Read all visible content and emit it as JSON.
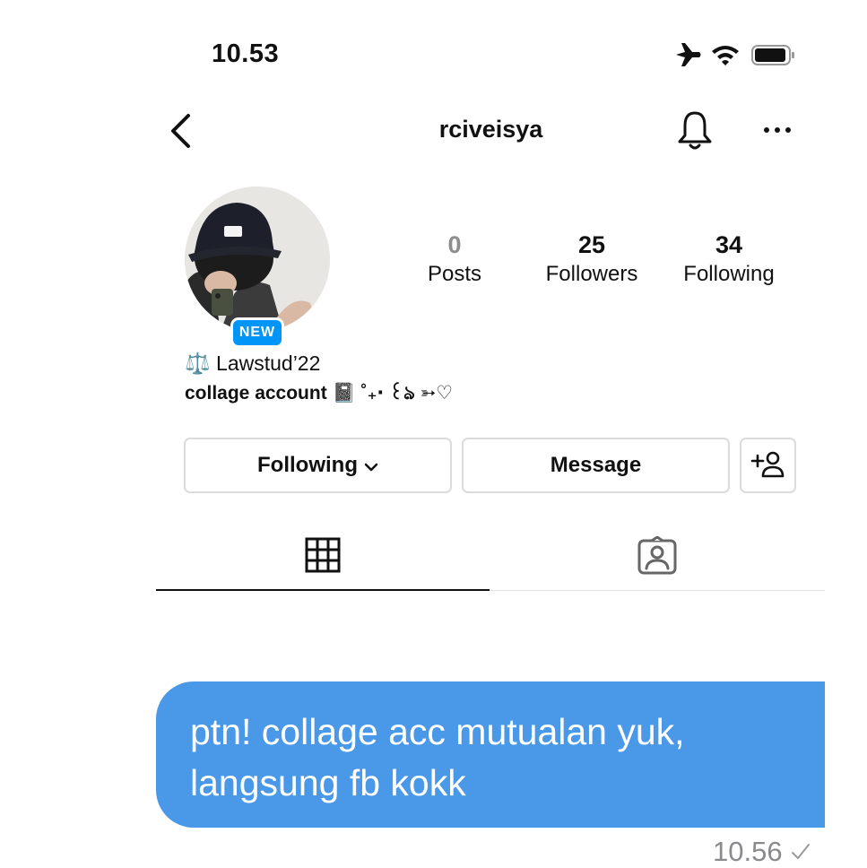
{
  "status_bar": {
    "time": "10.53"
  },
  "profile_header": {
    "username": "rciveisya"
  },
  "profile": {
    "badge": "NEW",
    "stats": {
      "posts": {
        "count": "0",
        "label": "Posts"
      },
      "followers": {
        "count": "25",
        "label": "Followers"
      },
      "following": {
        "count": "34",
        "label": "Following"
      }
    },
    "bio": {
      "name": "⚖️ Lawstud’22",
      "line": "collage account 📓 ˚₊‧ ꒰ঌ ➳♡"
    }
  },
  "actions": {
    "following_label": "Following",
    "message_label": "Message"
  },
  "tabs": {
    "active": "grid"
  },
  "chat_message": {
    "text_line1": "ptn! collage acc mutualan yuk,",
    "text_line2": "langsung fb kokk",
    "time": "10.56",
    "bubble_color": "#4a98e8"
  },
  "colors": {
    "accent": "#0095f6",
    "posts_count": "#8e8e8e"
  }
}
